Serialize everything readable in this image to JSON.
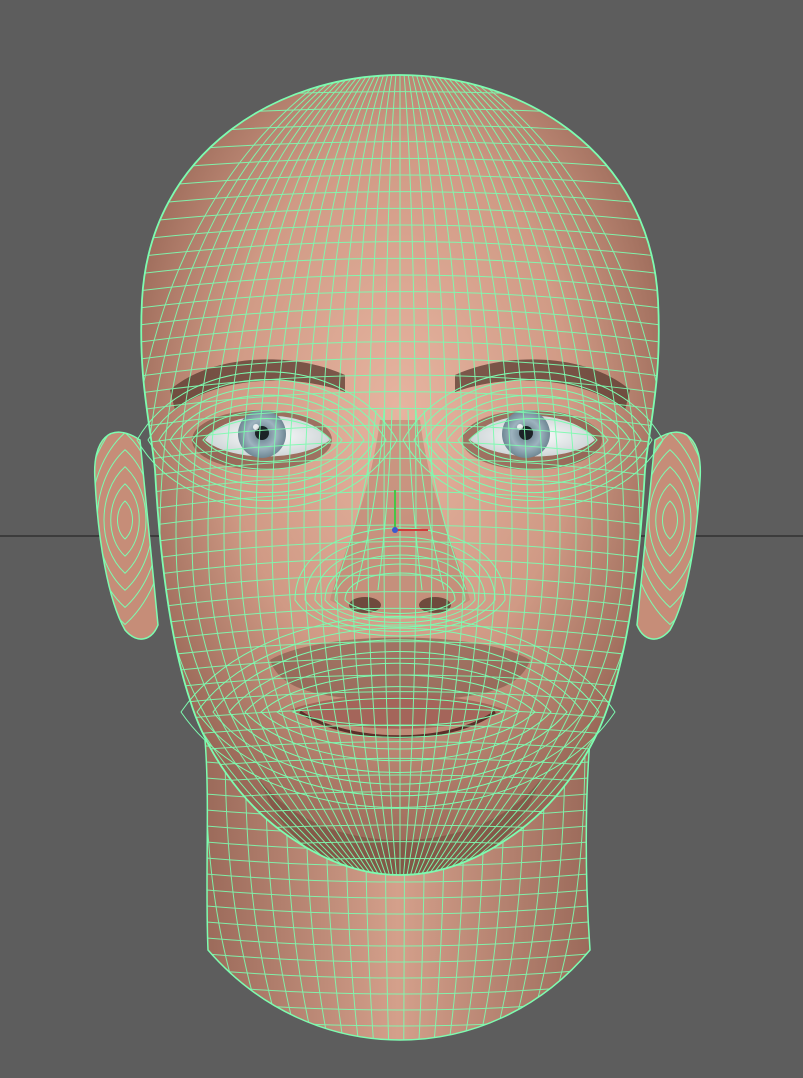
{
  "viewport": {
    "background_color": "#5d5d5d",
    "grid_line_color": "#3c3c3c"
  },
  "model": {
    "name_icon": "head-mesh",
    "display_mode": "wireframe-on-shaded",
    "wire_color": "#7dfcb0",
    "skin_color": "#d59a83",
    "skin_shadow_color": "#9e6a58",
    "iris_color": "#8fa6b2",
    "pupil_color": "#1c2226"
  },
  "manipulator": {
    "icon": "axis-gizmo-icon",
    "x_color": "#d23a3a",
    "y_color": "#46c646",
    "z_color": "#3a5ad2"
  }
}
